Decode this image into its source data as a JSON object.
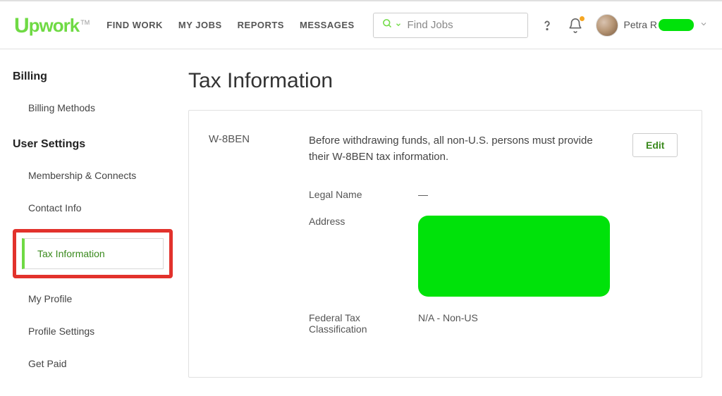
{
  "nav": {
    "find_work": "FIND WORK",
    "my_jobs": "MY JOBS",
    "reports": "REPORTS",
    "messages": "MESSAGES"
  },
  "search": {
    "placeholder": "Find Jobs"
  },
  "user": {
    "name_visible": "Petra R"
  },
  "sidebar": {
    "billing_title": "Billing",
    "billing_methods": "Billing Methods",
    "user_settings_title": "User Settings",
    "membership": "Membership & Connects",
    "contact_info": "Contact Info",
    "tax_info": "Tax Information",
    "my_profile": "My Profile",
    "profile_settings": "Profile Settings",
    "get_paid": "Get Paid"
  },
  "page": {
    "title": "Tax Information",
    "section_label": "W-8BEN",
    "section_desc": "Before withdrawing funds, all non-U.S. persons must provide their W-8BEN tax information.",
    "edit_label": "Edit",
    "fields": {
      "legal_name_label": "Legal Name",
      "legal_name_value": "—",
      "address_label": "Address",
      "federal_label": "Federal Tax Classification",
      "federal_value": "N/A - Non-US"
    }
  }
}
